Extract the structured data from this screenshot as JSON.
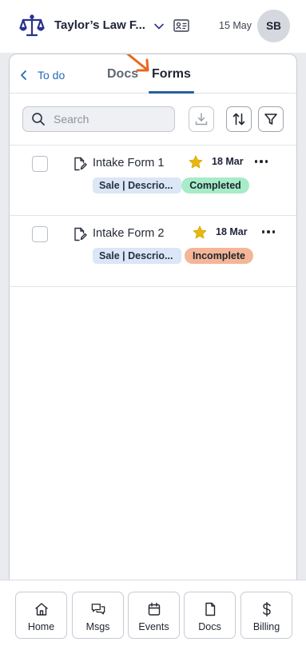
{
  "header": {
    "firm_name": "Taylor’s Law F...",
    "date": "15 May",
    "avatar_initials": "SB"
  },
  "tabs": {
    "back_label": "To do",
    "docs_label": "Docs",
    "forms_label": "Forms",
    "active": "Forms"
  },
  "toolbar": {
    "search_placeholder": "Search"
  },
  "forms": [
    {
      "name": "Intake Form 1",
      "starred": true,
      "date": "18 Mar",
      "tag": "Sale | Descrio...",
      "status": "Completed",
      "status_color": "#a6ecc7"
    },
    {
      "name": "Intake Form 2",
      "starred": true,
      "date": "18 Mar",
      "tag": "Sale | Descrio...",
      "status": "Incomplete",
      "status_color": "#f5b597"
    }
  ],
  "bottom_nav": [
    {
      "label": "Home",
      "icon": "home-icon"
    },
    {
      "label": "Msgs",
      "icon": "messages-icon"
    },
    {
      "label": "Events",
      "icon": "calendar-icon"
    },
    {
      "label": "Docs",
      "icon": "document-icon"
    },
    {
      "label": "Billing",
      "icon": "dollar-icon"
    }
  ],
  "colors": {
    "accent": "#2b5fa0",
    "link": "#2468b8",
    "logo": "#2b3290",
    "star": "#e7b80c",
    "annotation_arrow": "#e8691f"
  }
}
